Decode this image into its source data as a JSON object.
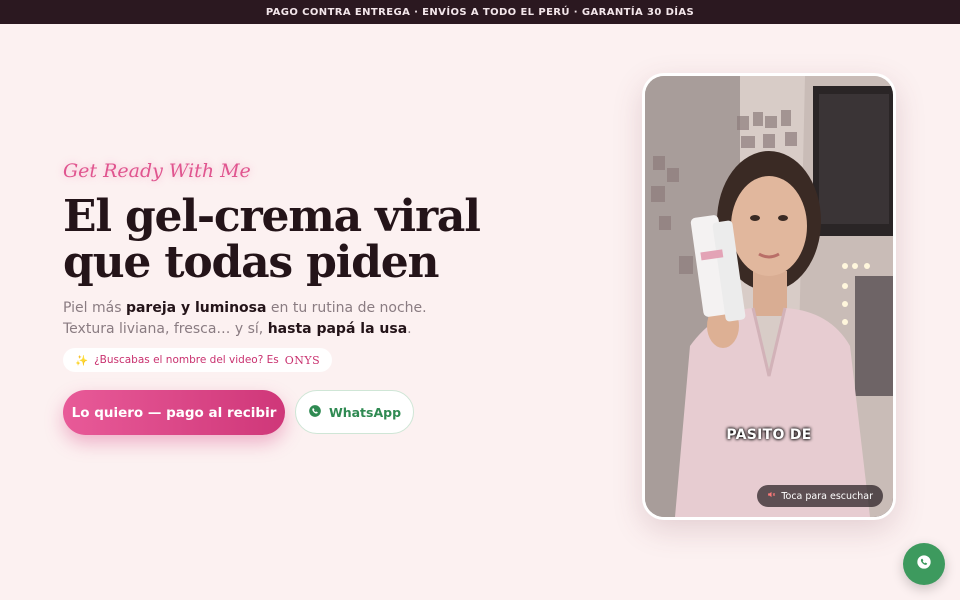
{
  "topbar": {
    "text": "PAGO CONTRA ENTREGA · ENVÍOS A TODO EL PERÚ · GARANTÍA 30 DÍAS"
  },
  "hero": {
    "kicker": "Get Ready With Me",
    "headline_line1": "El gel-crema viral",
    "headline_line2": "que todas piden",
    "sub_line1": {
      "a": "Piel más ",
      "b": "pareja y luminosa",
      "c": " en tu rutina de noche."
    },
    "sub_line2": {
      "a": "Textura liviana, fresca… y sí, ",
      "b": "hasta papá la usa",
      "c": "."
    },
    "pill": {
      "emoji": "✨",
      "text": "¿Buscabas el nombre del video? Es",
      "brand": "ONYS"
    },
    "cta_primary": "Lo quiero — pago al recibir",
    "cta_whatsapp": "WhatsApp"
  },
  "video": {
    "caption": "PASITO DE",
    "sound_label": "Toca para escuchar",
    "sound_icon": "muted-speaker-icon"
  },
  "fab": {
    "icon": "whatsapp-icon"
  },
  "colors": {
    "accent": "#e0558f",
    "topbar_bg": "#2b1820",
    "page_bg": "#fcf1f1",
    "whatsapp": "#3d9a5e"
  }
}
